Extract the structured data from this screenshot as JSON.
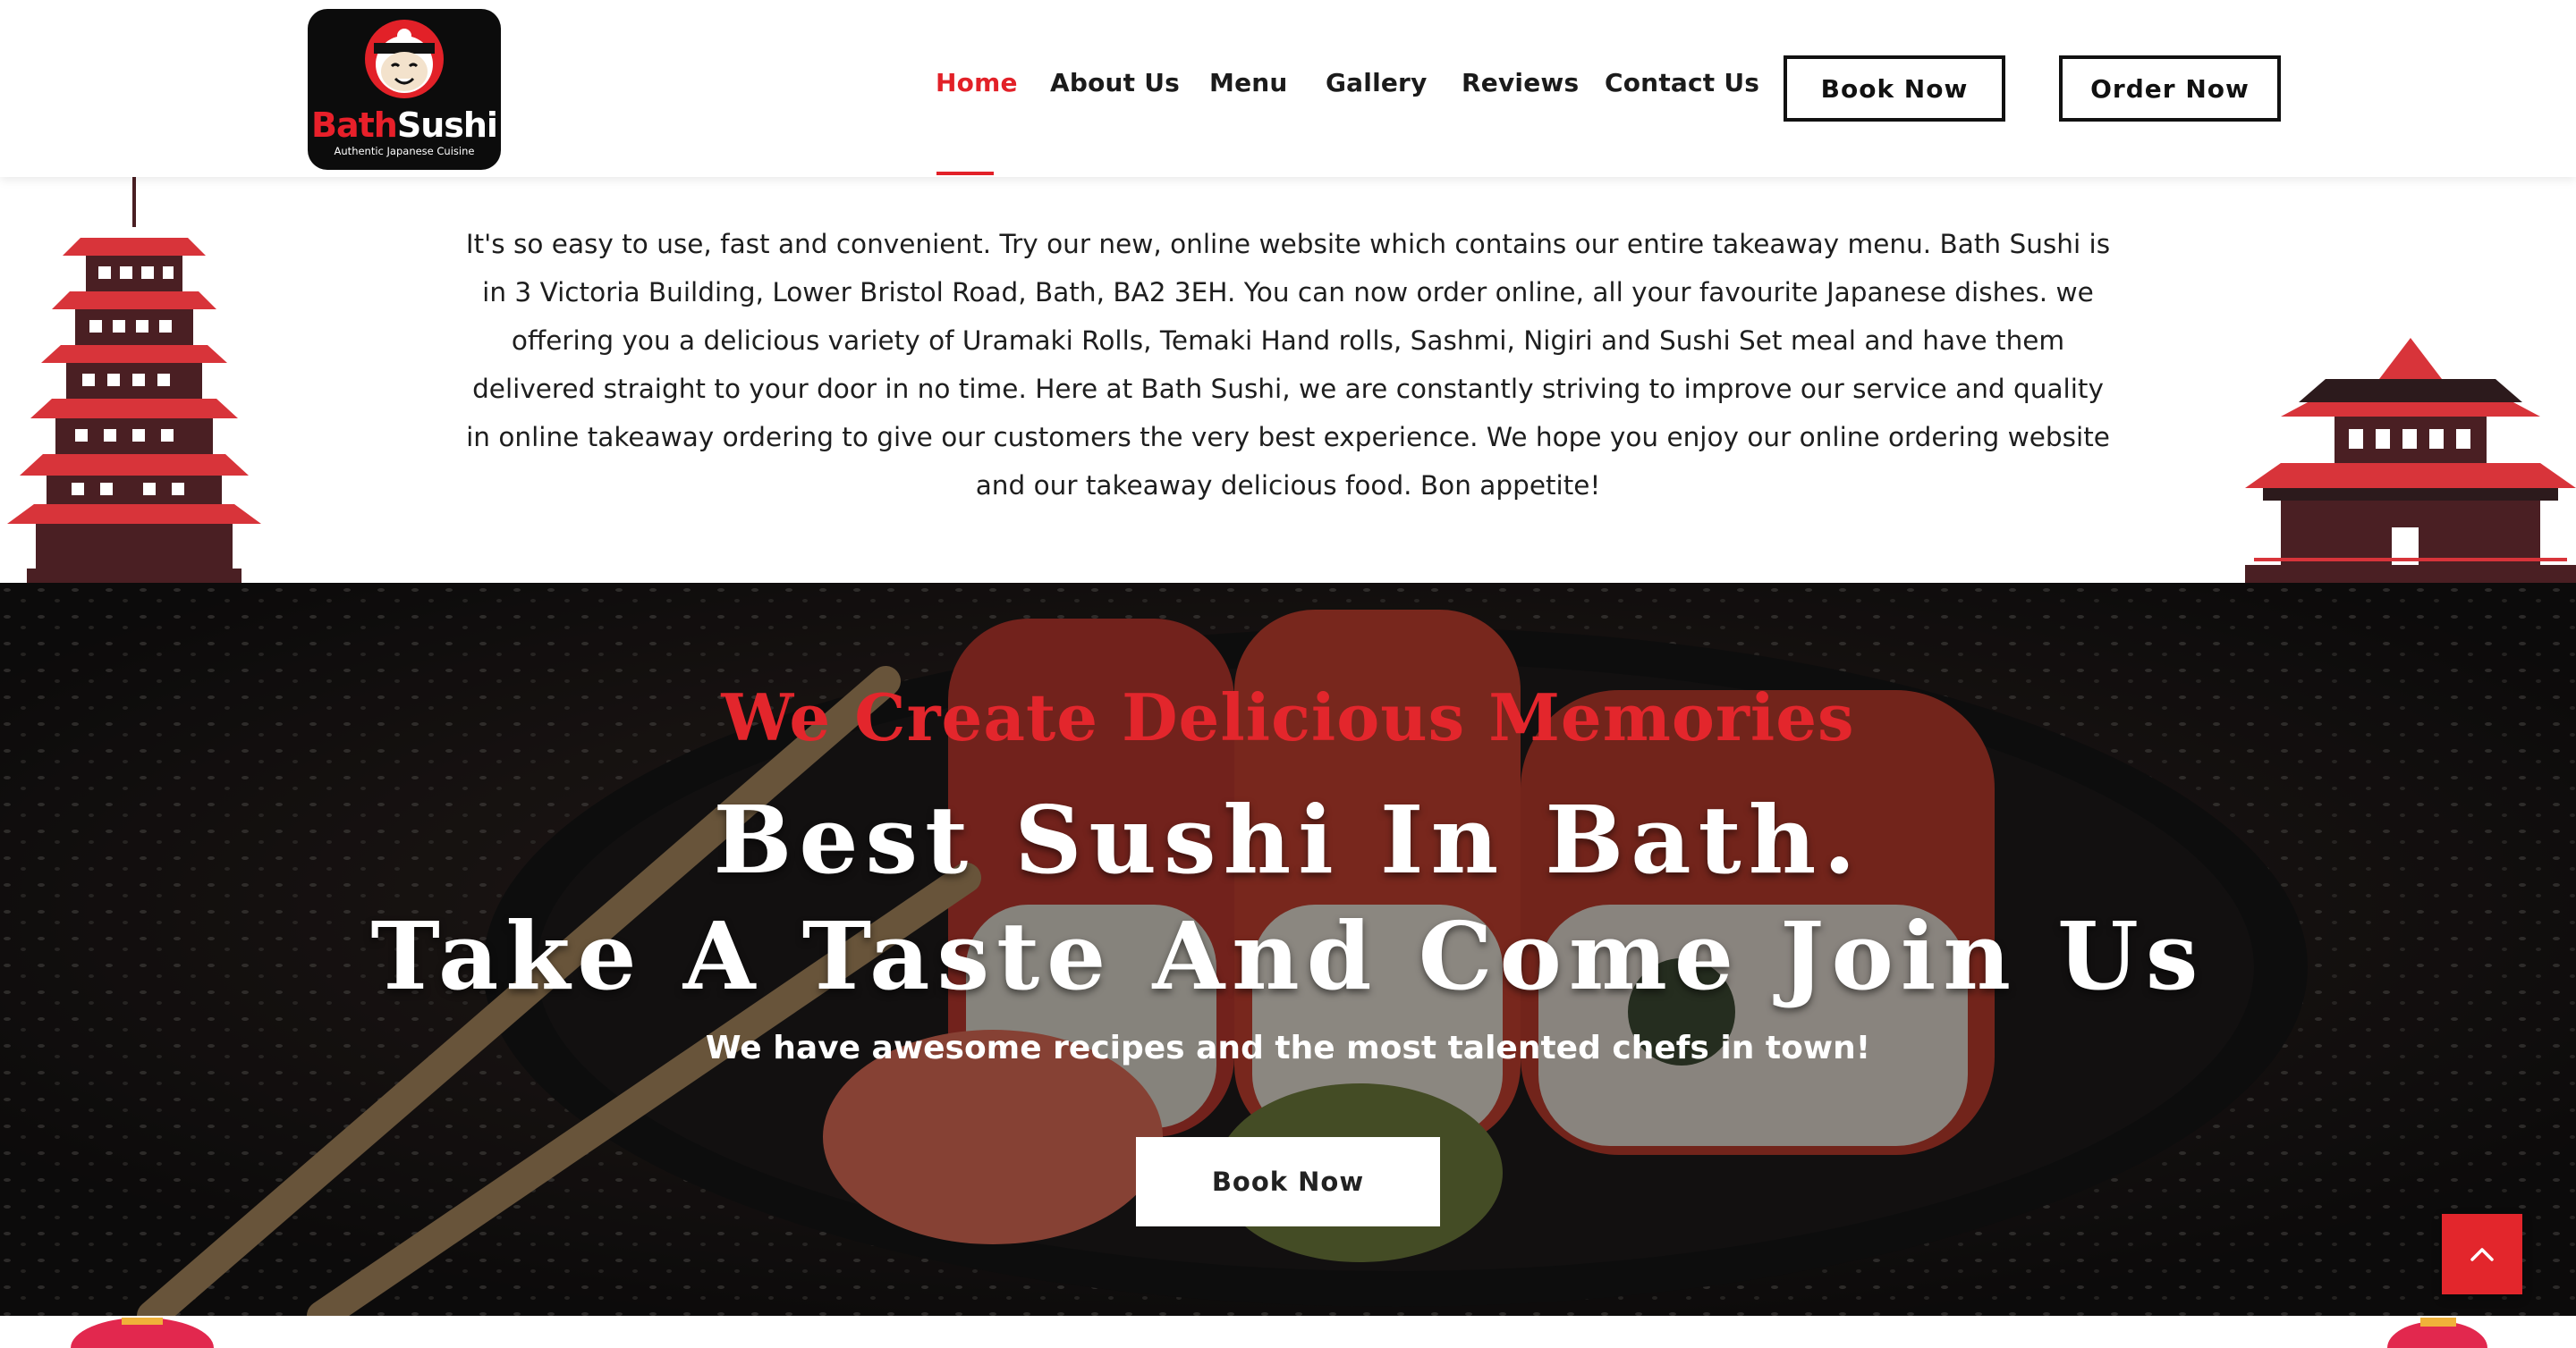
{
  "header": {
    "logo_brand_part1": "Bath",
    "logo_brand_part2": "Sushi",
    "logo_tagline": "Authentic Japanese Cuisine",
    "nav": [
      {
        "label": "Home",
        "active": true
      },
      {
        "label": "About Us",
        "active": false
      },
      {
        "label": "Menu",
        "active": false
      },
      {
        "label": "Gallery",
        "active": false
      },
      {
        "label": "Reviews",
        "active": false
      },
      {
        "label": "Contact Us",
        "active": false
      }
    ],
    "book_now_label": "Book Now",
    "order_now_label": "Order Now"
  },
  "intro": {
    "text": "It's so easy to use, fast and convenient. Try our new, online website which contains our entire takeaway menu. Bath Sushi is in 3 Victoria Building, Lower Bristol Road, Bath, BA2 3EH. You can now order online, all your favourite Japanese dishes. we offering you a delicious variety of Uramaki Rolls, Temaki Hand rolls, Sashmi, Nigiri and Sushi Set meal and have them delivered straight to your door in no time. Here at Bath Sushi, we are constantly striving to improve our service and quality in online takeaway ordering to give our customers the very best experience. We hope you enjoy our online ordering website and our takeaway delicious food. Bon appetite!"
  },
  "hero": {
    "kicker": "We Create Delicious Memories",
    "title_line1": "Best Sushi In Bath.",
    "title_line2": "Take A Taste And Come Join Us",
    "subtitle": "We have awesome recipes and the most talented chefs in town!",
    "button_label": "Book Now"
  },
  "colors": {
    "accent": "#e22128",
    "dark": "#111111",
    "pagoda_red": "#d8343a",
    "pagoda_dark": "#4a1f23"
  },
  "icons": {
    "scroll_top": "chevron-up-icon"
  }
}
